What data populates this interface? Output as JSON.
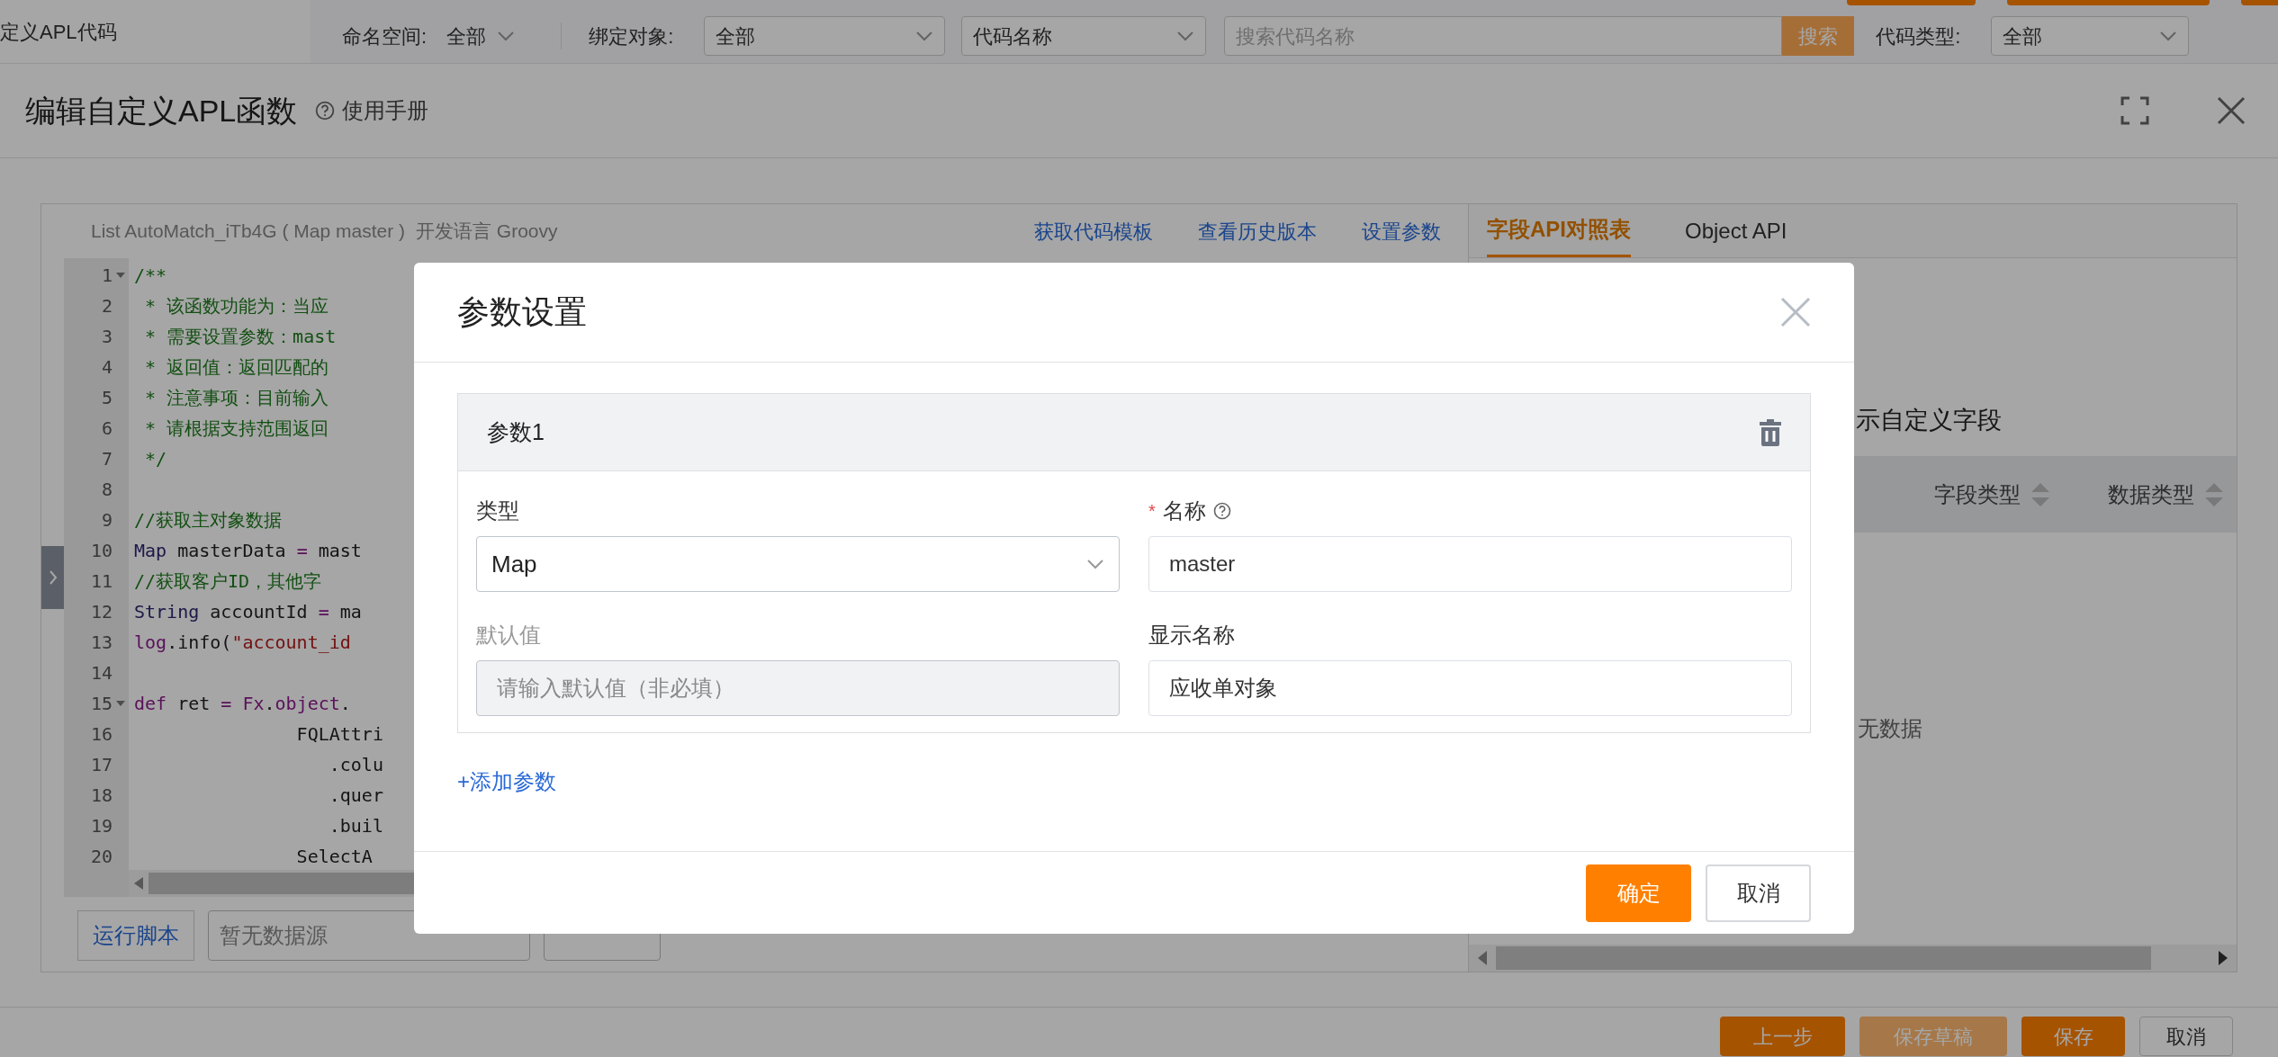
{
  "nav": {
    "item": "定义APL代码"
  },
  "filters": {
    "namespace_label": "命名空间:",
    "namespace_value": "全部",
    "bind_label": "绑定对象:",
    "bind_value": "全部",
    "name_field_value": "代码名称",
    "search_placeholder": "搜索代码名称",
    "search_button": "搜索",
    "type_label": "代码类型:",
    "type_value": "全部"
  },
  "dialog": {
    "title": "编辑自定义APL函数",
    "help_link": "使用手册"
  },
  "editor": {
    "signature": "List AutoMatch_iTb4G ( Map master )",
    "language": "开发语言 Groovy",
    "links": [
      "获取代码模板",
      "查看历史版本",
      "设置参数"
    ],
    "lines": [
      {
        "number": "1",
        "foldable": true,
        "tokens": [
          {
            "kind": "comment",
            "text": "/**"
          }
        ]
      },
      {
        "number": "2",
        "foldable": false,
        "tokens": [
          {
            "kind": "comment",
            "text": " * 该函数功能为：当应"
          }
        ]
      },
      {
        "number": "3",
        "foldable": false,
        "tokens": [
          {
            "kind": "comment",
            "text": " * 需要设置参数：mast"
          }
        ]
      },
      {
        "number": "4",
        "foldable": false,
        "tokens": [
          {
            "kind": "comment",
            "text": " * 返回值：返回匹配的"
          }
        ]
      },
      {
        "number": "5",
        "foldable": false,
        "tokens": [
          {
            "kind": "comment",
            "text": " * 注意事项：目前输入"
          }
        ]
      },
      {
        "number": "6",
        "foldable": false,
        "tokens": [
          {
            "kind": "comment",
            "text": " * 请根据支持范围返回"
          }
        ]
      },
      {
        "number": "7",
        "foldable": false,
        "tokens": [
          {
            "kind": "comment",
            "text": " */"
          }
        ]
      },
      {
        "number": "8",
        "foldable": false
      },
      {
        "number": "9",
        "foldable": false,
        "tokens": [
          {
            "kind": "comment",
            "text": "//获取主对象数据"
          }
        ]
      },
      {
        "number": "10",
        "foldable": false,
        "tokens": [
          {
            "kind": "type",
            "text": "Map"
          },
          {
            "kind": "plain",
            "text": " masterData "
          },
          {
            "kind": "keyword",
            "text": "="
          },
          {
            "kind": "plain",
            "text": " mast"
          }
        ]
      },
      {
        "number": "11",
        "foldable": false,
        "tokens": [
          {
            "kind": "comment",
            "text": "//获取客户ID，其他字"
          }
        ]
      },
      {
        "number": "12",
        "foldable": false,
        "tokens": [
          {
            "kind": "type",
            "text": "String"
          },
          {
            "kind": "plain",
            "text": " accountId "
          },
          {
            "kind": "keyword",
            "text": "="
          },
          {
            "kind": "plain",
            "text": " ma"
          }
        ]
      },
      {
        "number": "13",
        "foldable": false,
        "tokens": [
          {
            "kind": "keyword",
            "text": "log"
          },
          {
            "kind": "plain",
            "text": ".info("
          },
          {
            "kind": "string",
            "text": "\"account_id"
          }
        ]
      },
      {
        "number": "14",
        "foldable": false
      },
      {
        "number": "15",
        "foldable": true,
        "tokens": [
          {
            "kind": "keyword",
            "text": "def"
          },
          {
            "kind": "plain",
            "text": " ret "
          },
          {
            "kind": "keyword",
            "text": "="
          },
          {
            "kind": "keyword",
            "text": " Fx"
          },
          {
            "kind": "plain",
            "text": "."
          },
          {
            "kind": "keyword",
            "text": "object"
          },
          {
            "kind": "plain",
            "text": "."
          }
        ]
      },
      {
        "number": "16",
        "foldable": false,
        "tokens": [
          {
            "kind": "plain",
            "text": "               FQLAttri"
          }
        ]
      },
      {
        "number": "17",
        "foldable": false,
        "tokens": [
          {
            "kind": "plain",
            "text": "                  .colu"
          }
        ]
      },
      {
        "number": "18",
        "foldable": false,
        "tokens": [
          {
            "kind": "plain",
            "text": "                  .quer"
          }
        ]
      },
      {
        "number": "19",
        "foldable": false,
        "tokens": [
          {
            "kind": "plain",
            "text": "                  .buil"
          }
        ]
      },
      {
        "number": "20",
        "foldable": false,
        "tokens": [
          {
            "kind": "plain",
            "text": "               SelectA"
          }
        ]
      }
    ],
    "run_button": "运行脚本",
    "datasource_placeholder": "暂无数据源"
  },
  "reference": {
    "tabs": [
      {
        "label": "字段API对照表",
        "selected": true
      },
      {
        "label": "Object API",
        "selected": false
      }
    ],
    "custom_fields_label": "示自定义字段",
    "columns": [
      "字段类型",
      "数据类型"
    ],
    "empty": "无数据"
  },
  "footer_buttons": [
    {
      "label": "上一步",
      "kind": "primary"
    },
    {
      "label": "保存草稿",
      "kind": "disabled"
    },
    {
      "label": "保存",
      "kind": "primary"
    },
    {
      "label": "取消",
      "kind": "default"
    }
  ],
  "modal": {
    "title": "参数设置",
    "param": {
      "title": "参数1",
      "fields": [
        {
          "label": "类型",
          "kind": "select",
          "value": "Map",
          "disabled": false,
          "help": false
        },
        {
          "label": "名称",
          "kind": "text",
          "value": "master",
          "required_mark": "*",
          "disabled": false,
          "help": true
        },
        {
          "label": "默认值",
          "kind": "text",
          "placeholder": "请输入默认值（非必填）",
          "disabled": true,
          "help": false
        },
        {
          "label": "显示名称",
          "kind": "text",
          "value": "应收单对象",
          "disabled": false,
          "help": false
        }
      ]
    },
    "add_link": "+添加参数",
    "buttons": [
      {
        "label": "确定",
        "kind": "primary"
      },
      {
        "label": "取消",
        "kind": "default"
      }
    ]
  }
}
